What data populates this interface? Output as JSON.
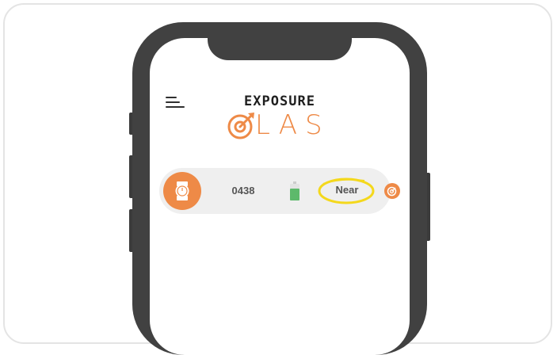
{
  "app": {
    "logo_line1": "EXPOSURE",
    "logo_line2": "LAS",
    "logo_icon": "target-o-icon",
    "menu_icon": "hamburger-menu-icon"
  },
  "device": {
    "id": "0438",
    "status": "Near",
    "avatar_icon": "watch-icon",
    "battery_icon": "battery-icon",
    "action_icon": "target-icon"
  },
  "colors": {
    "brand_orange": "#EE8A47",
    "battery_green": "#5DB96B",
    "highlight_yellow": "#F4D81C",
    "phone_body": "#414141"
  }
}
